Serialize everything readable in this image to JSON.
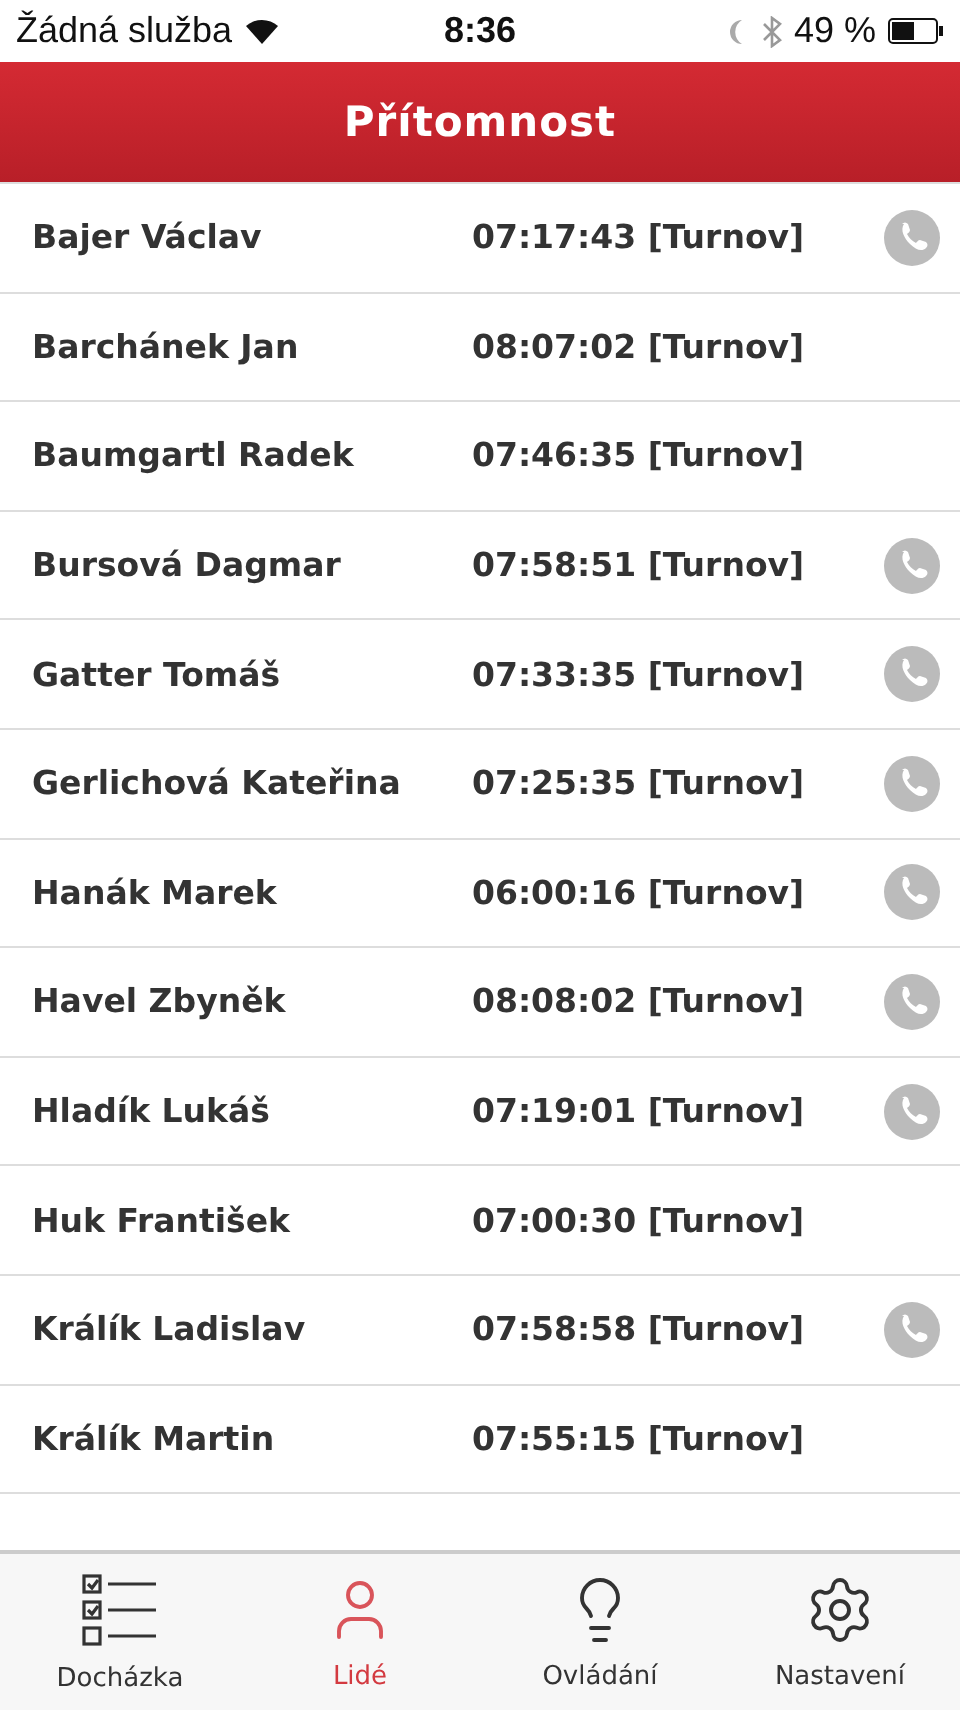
{
  "status_bar": {
    "carrier": "Žádná služba",
    "time": "8:36",
    "battery": "49 %"
  },
  "header": {
    "title": "Přítomnost"
  },
  "people": [
    {
      "name": "Bajer Václav",
      "arrival": "07:17:43 [Turnov]",
      "phone": true
    },
    {
      "name": "Barchánek Jan",
      "arrival": "08:07:02 [Turnov]",
      "phone": false
    },
    {
      "name": "Baumgartl Radek",
      "arrival": "07:46:35 [Turnov]",
      "phone": false
    },
    {
      "name": "Bursová Dagmar",
      "arrival": "07:58:51 [Turnov]",
      "phone": true
    },
    {
      "name": "Gatter Tomáš",
      "arrival": "07:33:35 [Turnov]",
      "phone": true
    },
    {
      "name": "Gerlichová Kateřina",
      "arrival": "07:25:35 [Turnov]",
      "phone": true
    },
    {
      "name": "Hanák Marek",
      "arrival": "06:00:16 [Turnov]",
      "phone": true
    },
    {
      "name": "Havel Zbyněk",
      "arrival": "08:08:02 [Turnov]",
      "phone": true
    },
    {
      "name": "Hladík Lukáš",
      "arrival": "07:19:01 [Turnov]",
      "phone": true
    },
    {
      "name": "Huk František",
      "arrival": "07:00:30 [Turnov]",
      "phone": false
    },
    {
      "name": "Králík Ladislav",
      "arrival": "07:58:58 [Turnov]",
      "phone": true
    },
    {
      "name": "Králík Martin",
      "arrival": "07:55:15 [Turnov]",
      "phone": false
    }
  ],
  "tabs": [
    {
      "kind": "checklist",
      "label": "Docházka",
      "selected": false
    },
    {
      "kind": "person",
      "label": "Lidé",
      "selected": true
    },
    {
      "kind": "bulb",
      "label": "Ovládání",
      "selected": false
    },
    {
      "kind": "gear",
      "label": "Nastavení",
      "selected": false
    }
  ]
}
